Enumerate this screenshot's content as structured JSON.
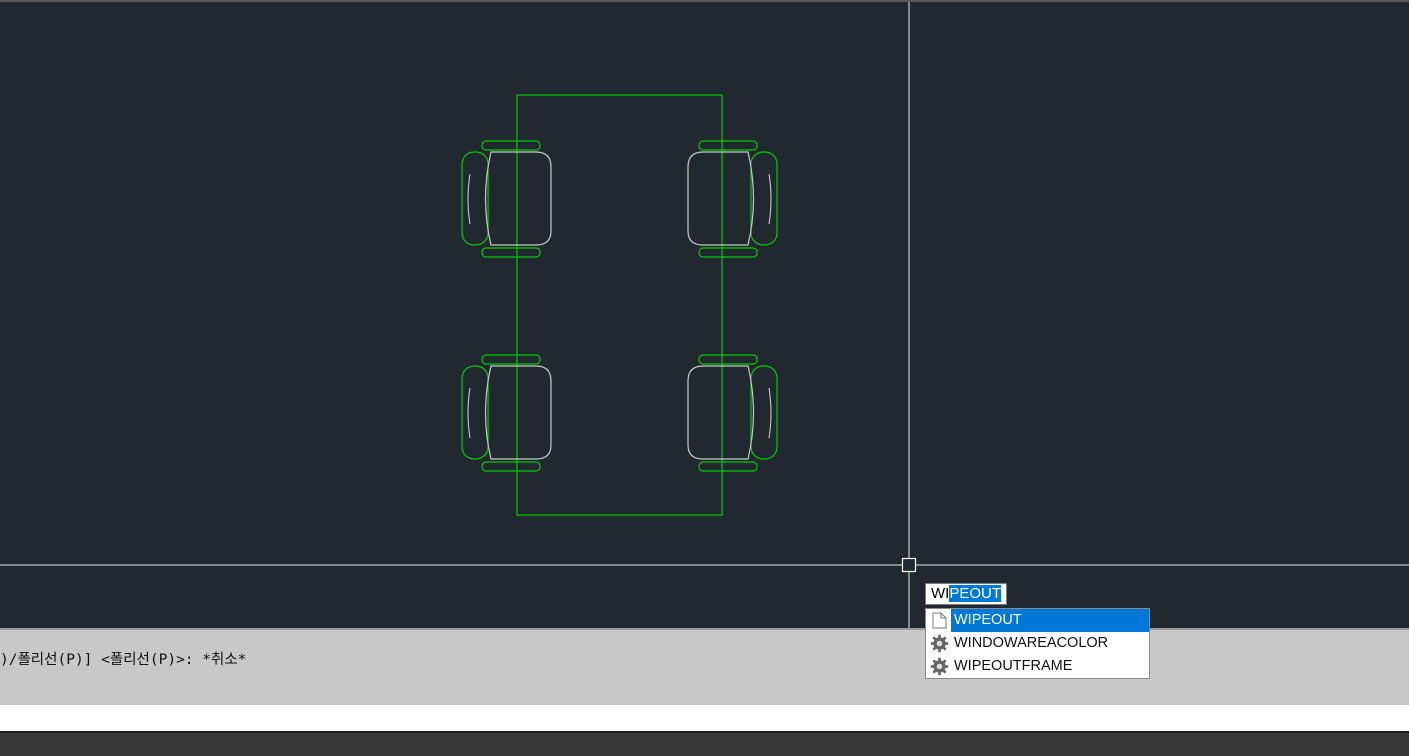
{
  "colors": {
    "background": "#212830",
    "geometry_green": "#00cc00",
    "chair_seat": "#c8c8c8",
    "crosshair": "#e6e6e6",
    "selection": "#0078d7"
  },
  "dynamic_input": {
    "typed": "WI",
    "suggested_completion": "PEOUT"
  },
  "autocomplete": {
    "items": [
      {
        "label": "WIPEOUT",
        "icon": "command-icon",
        "active": true
      },
      {
        "label": "WINDOWAREACOLOR",
        "icon": "gear-icon",
        "active": false
      },
      {
        "label": "WIPEOUTFRAME",
        "icon": "gear-icon",
        "active": false
      }
    ]
  },
  "command_history": {
    "line": ")/폴리선(P)] <폴리선(P)>: *취소*"
  },
  "command_line": {
    "value": ""
  }
}
